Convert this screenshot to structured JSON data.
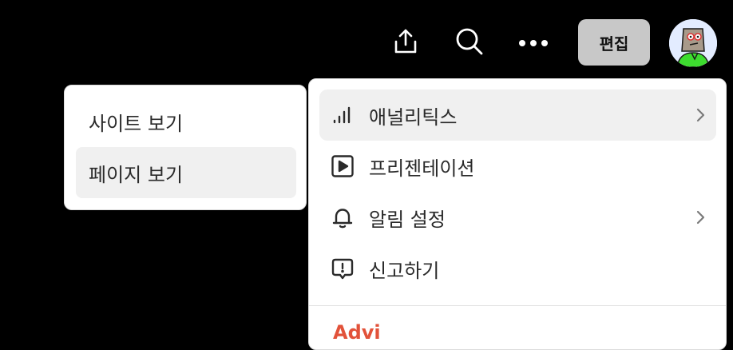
{
  "toolbar": {
    "share_icon": "share-upload-icon",
    "search_icon": "search-icon",
    "more_icon": "more-horizontal-icon",
    "edit_label": "편집",
    "avatar_icon": "avatar-character-icon"
  },
  "submenu": {
    "items": [
      {
        "label": "사이트 보기",
        "active": false
      },
      {
        "label": "페이지 보기",
        "active": true
      }
    ]
  },
  "menu": {
    "items": [
      {
        "label": "애널리틱스",
        "icon": "analytics-bars-icon",
        "has_submenu": true,
        "active": true
      },
      {
        "label": "프리젠테이션",
        "icon": "play-icon",
        "has_submenu": false,
        "active": false
      },
      {
        "label": "알림 설정",
        "icon": "bell-icon",
        "has_submenu": true,
        "active": false
      },
      {
        "label": "신고하기",
        "icon": "report-icon",
        "has_submenu": false,
        "active": false
      }
    ],
    "danger_item": "Advi"
  },
  "colors": {
    "background": "#000000",
    "edit_button": "#c8c8c8",
    "active_row": "#f0f0f0",
    "danger": "#e2523a",
    "avatar_shirt": "#3ddc2f"
  }
}
